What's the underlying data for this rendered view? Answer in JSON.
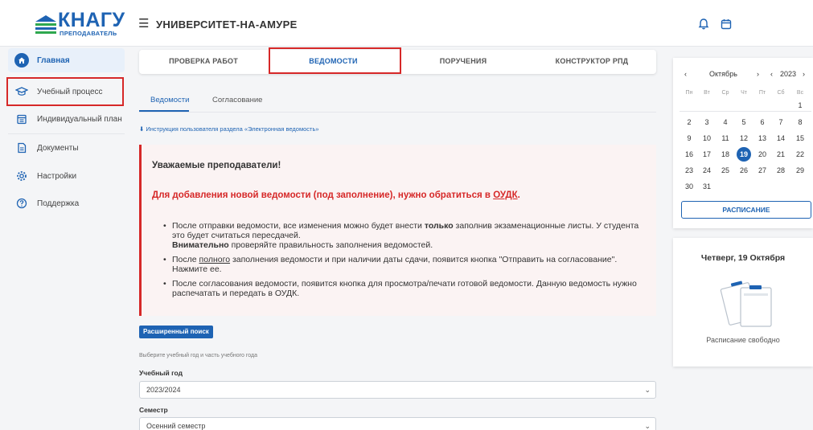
{
  "header": {
    "logo_text": "КНАГУ",
    "logo_sub": "ПРЕПОДАВАТЕЛЬ",
    "title": "УНИВЕРСИТЕТ-НА-АМУРЕ",
    "icons": [
      "bell-icon",
      "calendar-icon"
    ]
  },
  "sidebar": {
    "items": [
      {
        "label": "Главная",
        "icon": "home-icon"
      },
      {
        "label": "Учебный процесс",
        "icon": "graduation-cap-icon"
      },
      {
        "label": "Индивидуальный план",
        "icon": "planner-icon"
      },
      {
        "label": "Документы",
        "icon": "document-icon"
      },
      {
        "label": "Настройки",
        "icon": "gear-icon"
      },
      {
        "label": "Поддержка",
        "icon": "help-icon"
      }
    ]
  },
  "tabs": [
    {
      "label": "ПРОВЕРКА РАБОТ"
    },
    {
      "label": "ВЕДОМОСТИ"
    },
    {
      "label": "ПОРУЧЕНИЯ"
    },
    {
      "label": "КОНСТРУКТОР РПД"
    }
  ],
  "subtabs": [
    {
      "label": "Ведомости"
    },
    {
      "label": "Согласование"
    }
  ],
  "instruction_link": "Инструкция пользователя раздела «Электронная ведомость»",
  "alert": {
    "title": "Уважаемые преподаватели!",
    "warning_prefix": "Для добавления новой ведомости (под заполнение), нужно обратиться в ",
    "warning_link": "ОУДК",
    "warning_suffix": ".",
    "b1_a": "После отправки ведомости, все изменения можно будет внести ",
    "b1_bold": "только",
    "b1_b": " заполнив экзаменационные листы. У студента это будет считаться пересдачей.",
    "b1_bold2": "Внимательно",
    "b1_c": " проверяйте правильность заполнения ведомостей.",
    "b2_a": "После ",
    "b2_u": "полного",
    "b2_b": " заполнения ведомости и при наличии даты сдачи, появится кнопка \"Отправить на согласование\". Нажмите ее.",
    "b3": "После согласования ведомости, появится кнопка для просмотра/печати готовой ведомости. Данную ведомость нужно распечатать и передать в ОУДК."
  },
  "search": {
    "advanced_label": "Расширенный поиск",
    "hint": "Выберите учебный год и часть учебного года",
    "year_label": "Учебный год",
    "year_value": "2023/2024",
    "semester_label": "Семестр",
    "semester_value": "Осенний семестр"
  },
  "calendar": {
    "month": "Октябрь",
    "year": "2023",
    "prev": "‹",
    "next": "›",
    "dow": [
      "Пн",
      "Вт",
      "Ср",
      "Чт",
      "Пт",
      "Сб",
      "Вс"
    ],
    "weeks": [
      [
        "",
        "",
        "",
        "",
        "",
        "",
        "1"
      ],
      [
        "2",
        "3",
        "4",
        "5",
        "6",
        "7",
        "8"
      ],
      [
        "9",
        "10",
        "11",
        "12",
        "13",
        "14",
        "15"
      ],
      [
        "16",
        "17",
        "18",
        "19",
        "20",
        "21",
        "22"
      ],
      [
        "23",
        "24",
        "25",
        "26",
        "27",
        "28",
        "29"
      ],
      [
        "30",
        "31",
        "",
        "",
        "",
        "",
        ""
      ]
    ],
    "today": "19",
    "button": "РАСПИСАНИЕ"
  },
  "day": {
    "title": "Четверг, 19 Октября",
    "status": "Расписание свободно"
  },
  "colors": {
    "primary": "#1e63b3",
    "danger": "#d62828",
    "alert_bg": "#fbf3f3"
  }
}
